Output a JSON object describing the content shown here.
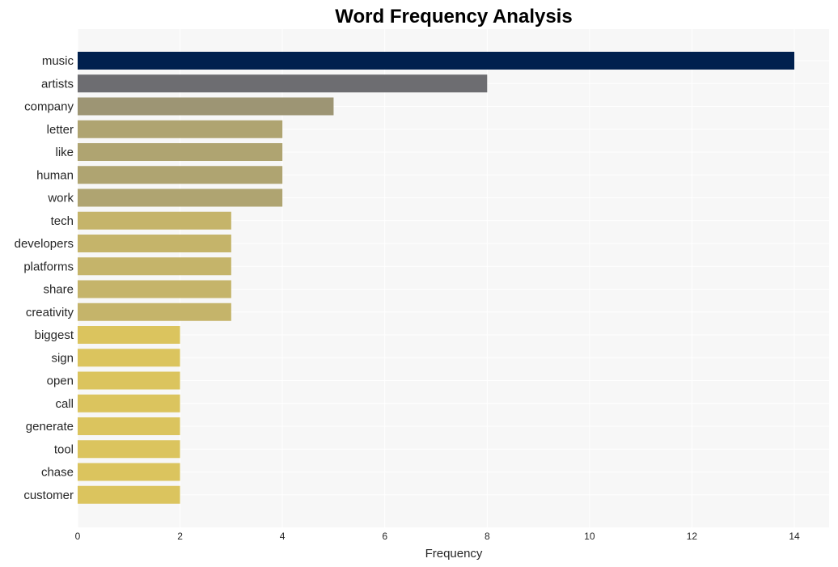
{
  "chart_data": {
    "type": "bar",
    "orientation": "horizontal",
    "title": "Word Frequency Analysis",
    "xlabel": "Frequency",
    "ylabel": "",
    "xlim": [
      0,
      14.7
    ],
    "xticks": [
      0,
      2,
      4,
      6,
      8,
      10,
      12,
      14
    ],
    "grid": true,
    "categories": [
      "music",
      "artists",
      "company",
      "letter",
      "like",
      "human",
      "work",
      "tech",
      "developers",
      "platforms",
      "share",
      "creativity",
      "biggest",
      "sign",
      "open",
      "call",
      "generate",
      "tool",
      "chase",
      "customer"
    ],
    "values": [
      14,
      8,
      5,
      4,
      4,
      4,
      4,
      3,
      3,
      3,
      3,
      3,
      2,
      2,
      2,
      2,
      2,
      2,
      2,
      2
    ],
    "colors": [
      "#00204e",
      "#6d6d71",
      "#9d9574",
      "#afa471",
      "#afa471",
      "#afa471",
      "#afa471",
      "#c5b46a",
      "#c5b46a",
      "#c5b46a",
      "#c5b46a",
      "#c5b46a",
      "#dbc45e",
      "#dbc45e",
      "#dbc45e",
      "#dbc45e",
      "#dbc45e",
      "#dbc45e",
      "#dbc45e",
      "#dbc45e"
    ],
    "plot_background": "#f7f7f7",
    "grid_color": "#ffffff"
  }
}
